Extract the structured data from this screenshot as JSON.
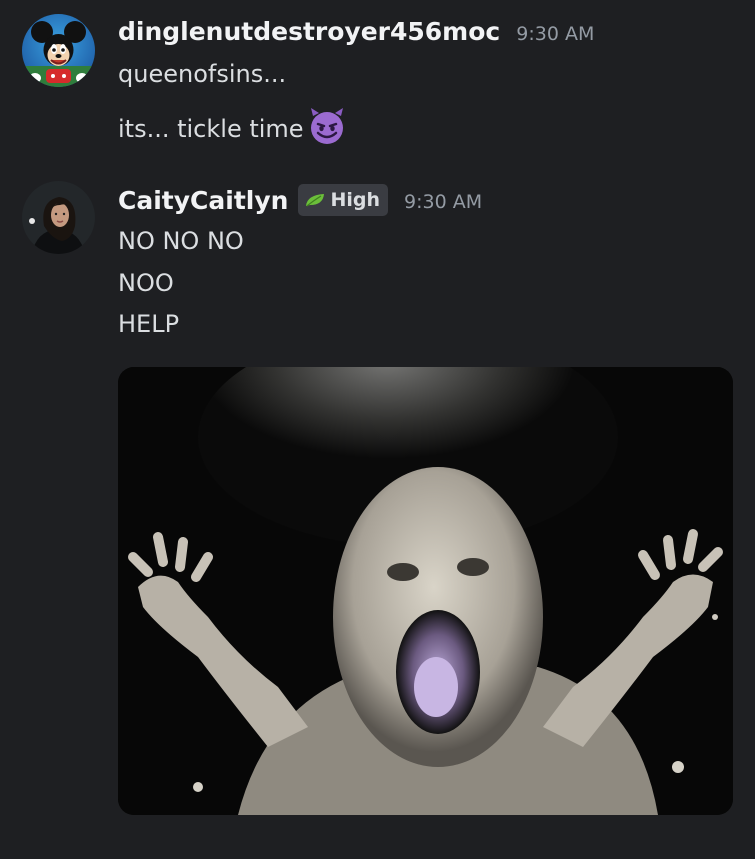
{
  "messages": [
    {
      "username": "dinglenutdestroyer456moc",
      "timestamp": "9:30 AM",
      "avatar_icon": "mickey-mouse-avatar-icon",
      "lines": [
        "queenofsins...",
        "its... tickle time"
      ],
      "emoji": "smiling-imp-emoji"
    },
    {
      "username": "CaityCaitlyn",
      "timestamp": "9:30 AM",
      "avatar_icon": "user-photo-avatar-icon",
      "role_tag": "High",
      "role_icon": "leaf-icon",
      "lines": [
        "NO NO NO",
        "NOO",
        "HELP"
      ],
      "attachment": "screaming-baby-image"
    }
  ],
  "colors": {
    "background": "#1e1f22",
    "username": "#f2f3f5",
    "timestamp": "#949ba4",
    "text": "#dbdee1",
    "role_tag_bg": "#3a3c42",
    "leaf": "#6bbf3a",
    "emoji": "#9b6bd0"
  }
}
